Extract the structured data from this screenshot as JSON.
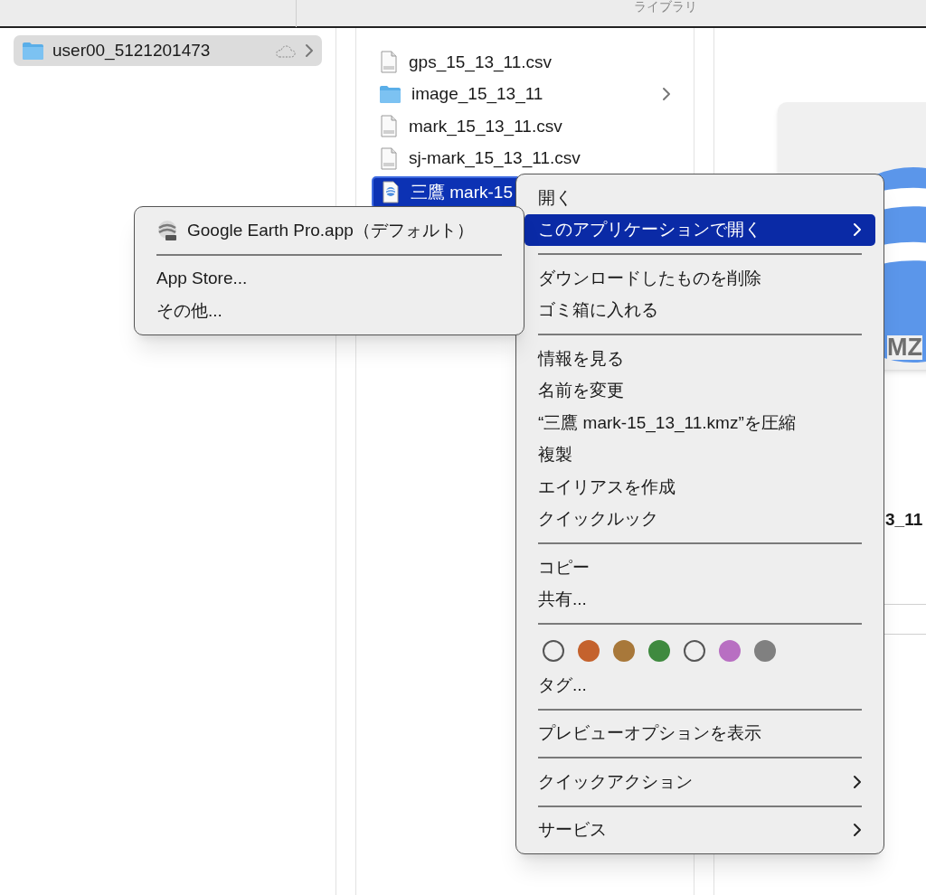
{
  "toolbar": {
    "title": "ライブラリ"
  },
  "sidebar": {
    "items": [
      {
        "label": "user00_5121201473",
        "selected": true,
        "cloud": true
      }
    ]
  },
  "files": [
    {
      "name": "gps_15_13_11.csv",
      "kind": "csv",
      "selected": false
    },
    {
      "name": "image_15_13_11",
      "kind": "folder",
      "selected": false
    },
    {
      "name": "mark_15_13_11.csv",
      "kind": "csv",
      "selected": false
    },
    {
      "name": "sj-mark_15_13_11.csv",
      "kind": "csv",
      "selected": false
    },
    {
      "name": "三鷹 mark-15",
      "kind": "kmz",
      "selected": true
    }
  ],
  "preview": {
    "icon_text": "MZ",
    "filename": "3_11"
  },
  "context_menu": {
    "items": [
      {
        "kind": "item",
        "label": "開く",
        "selected": false,
        "submenu": false
      },
      {
        "kind": "item",
        "label": "このアプリケーションで開く",
        "selected": true,
        "submenu": true
      },
      {
        "kind": "separator"
      },
      {
        "kind": "item",
        "label": "ダウンロードしたものを削除",
        "selected": false,
        "submenu": false
      },
      {
        "kind": "item",
        "label": "ゴミ箱に入れる",
        "selected": false,
        "submenu": false
      },
      {
        "kind": "separator"
      },
      {
        "kind": "item",
        "label": "情報を見る",
        "selected": false,
        "submenu": false
      },
      {
        "kind": "item",
        "label": "名前を変更",
        "selected": false,
        "submenu": false
      },
      {
        "kind": "item",
        "label": "“三鷹 mark-15_13_11.kmz”を圧縮",
        "selected": false,
        "submenu": false
      },
      {
        "kind": "item",
        "label": "複製",
        "selected": false,
        "submenu": false
      },
      {
        "kind": "item",
        "label": "エイリアスを作成",
        "selected": false,
        "submenu": false
      },
      {
        "kind": "item",
        "label": "クイックルック",
        "selected": false,
        "submenu": false
      },
      {
        "kind": "separator"
      },
      {
        "kind": "item",
        "label": "コピー",
        "selected": false,
        "submenu": false
      },
      {
        "kind": "item",
        "label": "共有...",
        "selected": false,
        "submenu": false
      },
      {
        "kind": "separator"
      },
      {
        "kind": "tags",
        "tags": [
          {
            "kind": "outline"
          },
          {
            "kind": "filled",
            "color": "#c4622d"
          },
          {
            "kind": "filled",
            "color": "#a8783a"
          },
          {
            "kind": "filled",
            "color": "#3f8a3f"
          },
          {
            "kind": "outline"
          },
          {
            "kind": "filled",
            "color": "#b86fc2"
          },
          {
            "kind": "filled",
            "color": "#808080"
          }
        ]
      },
      {
        "kind": "item",
        "label": "タグ...",
        "selected": false,
        "submenu": false
      },
      {
        "kind": "separator"
      },
      {
        "kind": "item",
        "label": "プレビューオプションを表示",
        "selected": false,
        "submenu": false
      },
      {
        "kind": "separator"
      },
      {
        "kind": "item",
        "label": "クイックアクション",
        "selected": false,
        "submenu": true
      },
      {
        "kind": "separator"
      },
      {
        "kind": "item",
        "label": "サービス",
        "selected": false,
        "submenu": true
      }
    ]
  },
  "open_with_menu": {
    "items": [
      {
        "kind": "app",
        "label": "Google Earth Pro.app（デフォルト）"
      },
      {
        "kind": "separator"
      },
      {
        "kind": "item",
        "label": "App Store..."
      },
      {
        "kind": "item",
        "label": "その他..."
      }
    ]
  }
}
